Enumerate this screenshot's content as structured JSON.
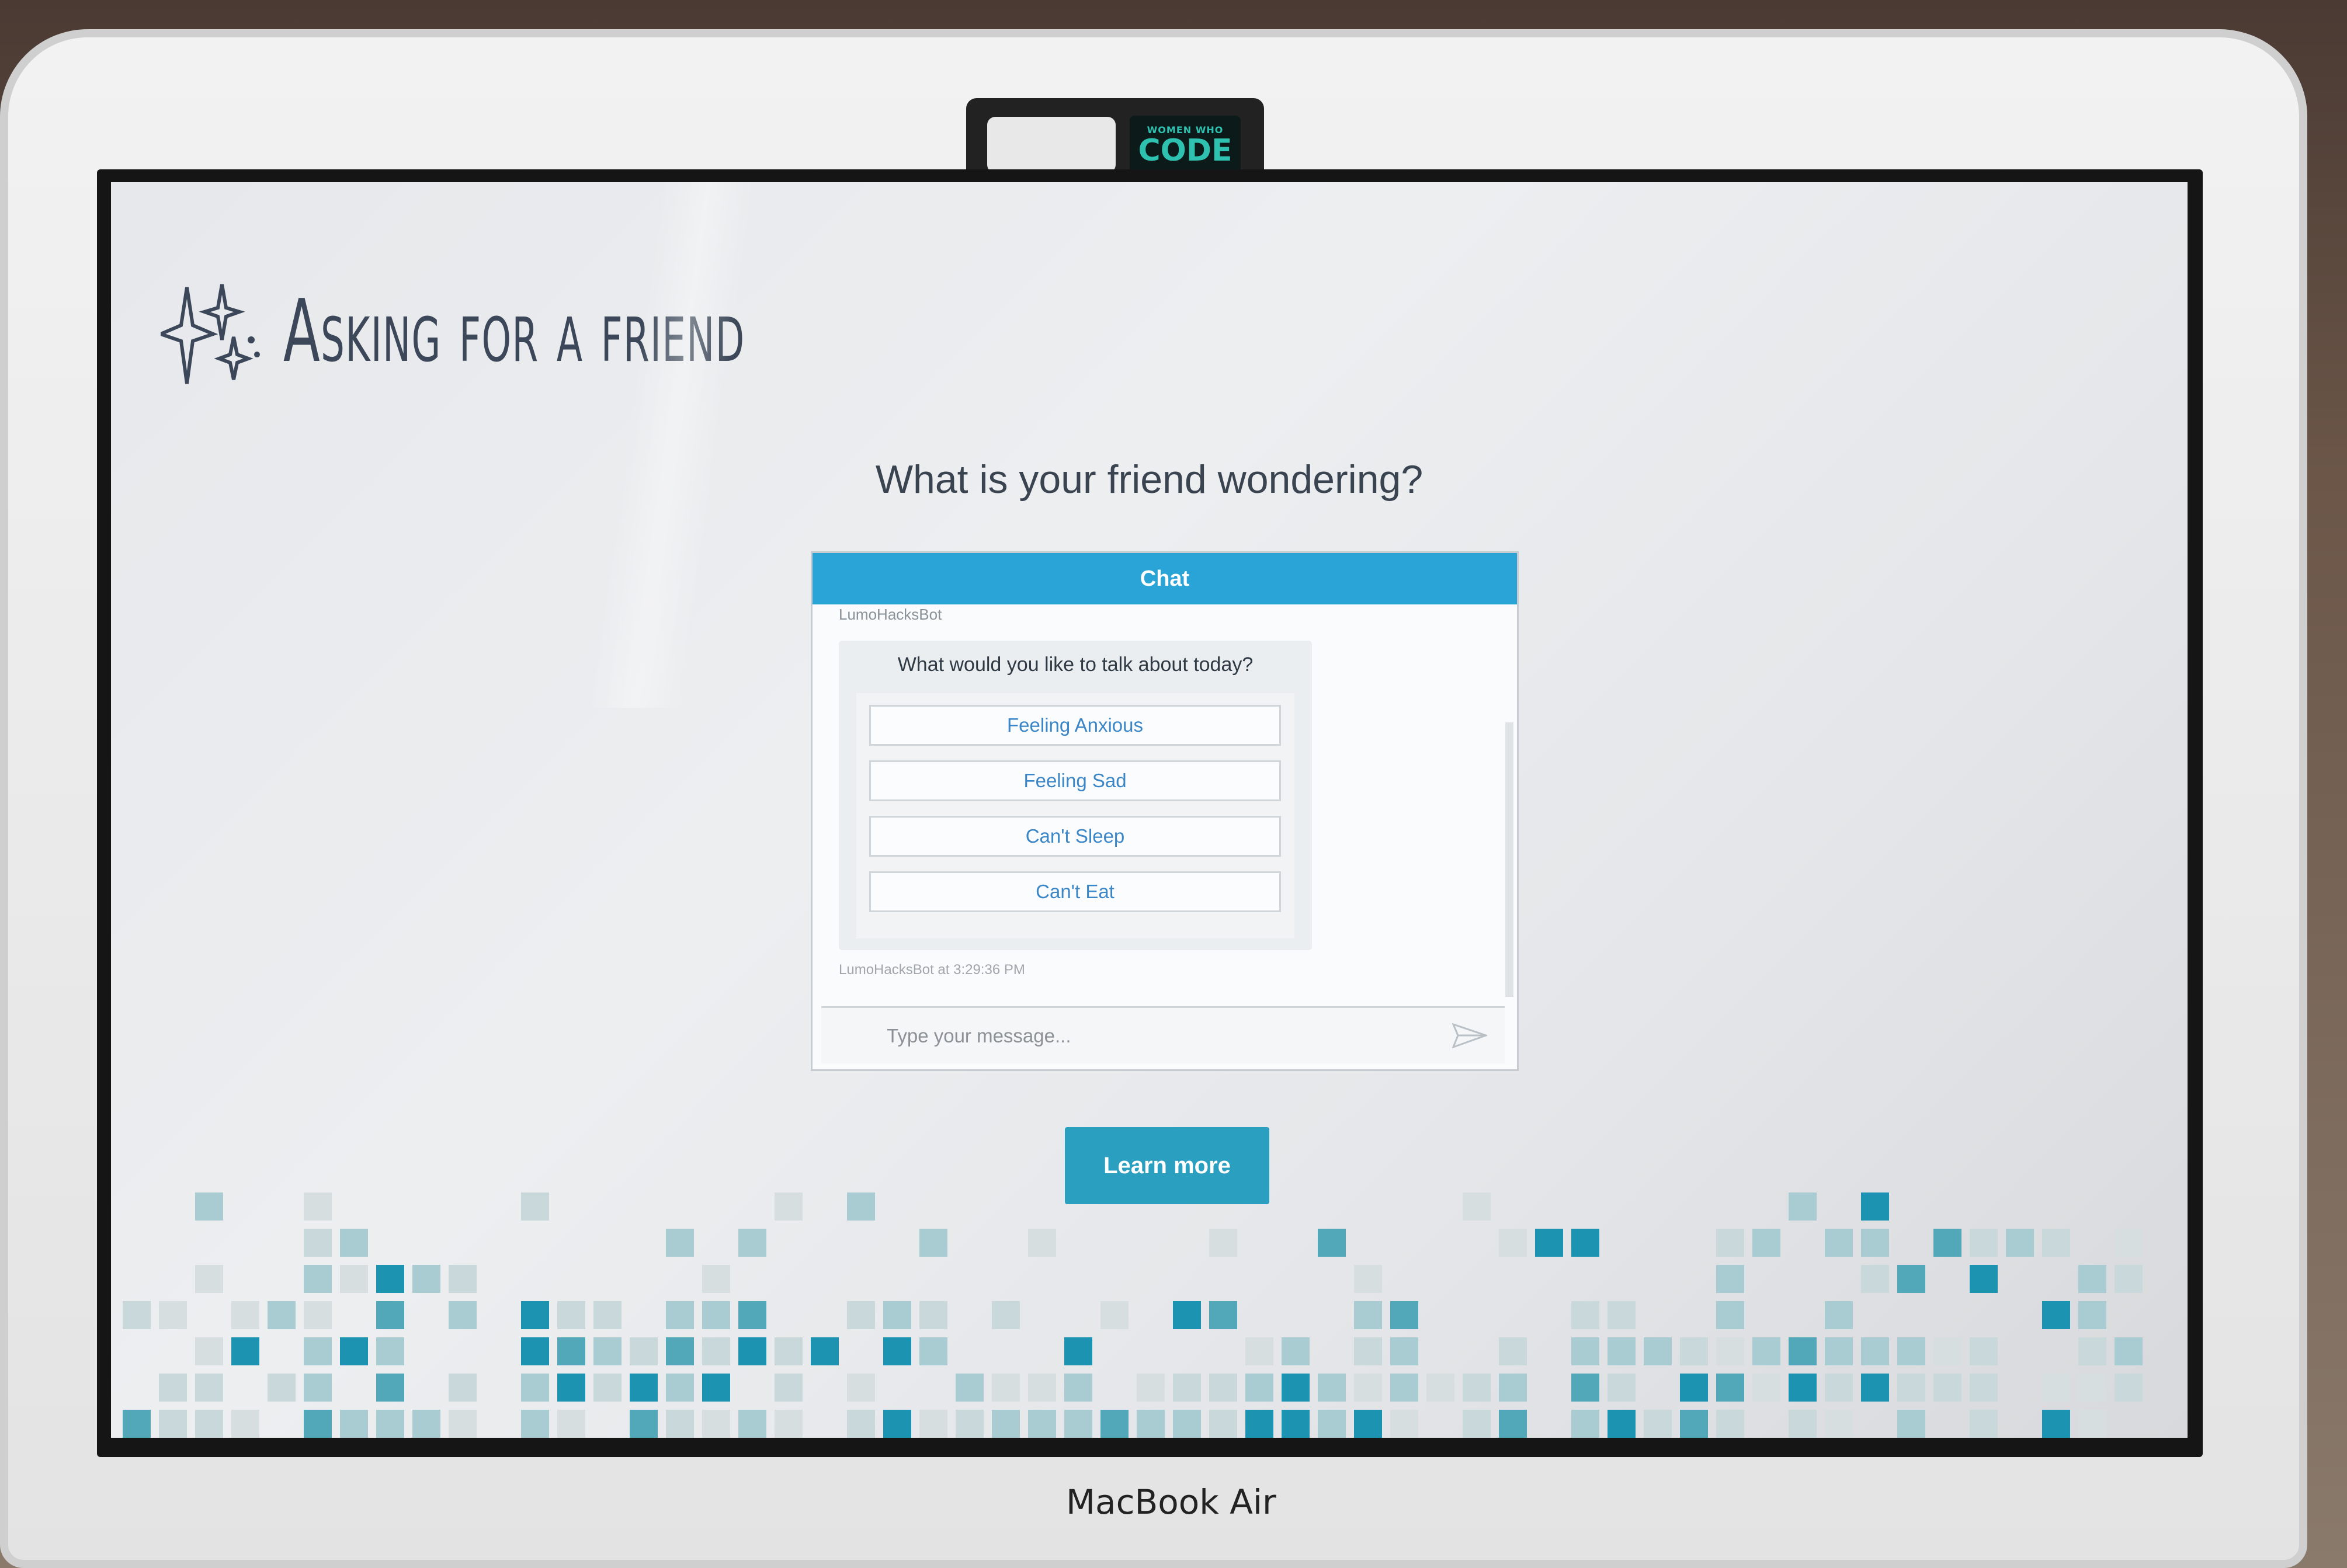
{
  "device": {
    "brand_label": "MacBook Air",
    "webcam_badge": {
      "top": "WOMEN WHO",
      "bottom": "CODE"
    }
  },
  "app": {
    "logo_title": "Asking for a friend",
    "heading": "What is your friend wondering?",
    "accent_color": "#2aa3d6",
    "button_color": "#2a9fc0"
  },
  "chat": {
    "header": "Chat",
    "bot_name": "LumoHacksBot",
    "question": "What would you like to talk about today?",
    "options": [
      "Feeling Anxious",
      "Feeling Sad",
      "Can't Sleep",
      "Can't Eat"
    ],
    "timestamp": "LumoHacksBot at 3:29:36 PM",
    "input_placeholder": "Type your message...",
    "send_icon": "send-arrow-icon"
  },
  "learn_more_label": "Learn more",
  "mosaic_colors": [
    "#1c93b0",
    "#52a7b8",
    "#a9ccd2",
    "#c9d8db",
    "#d6dee0"
  ]
}
